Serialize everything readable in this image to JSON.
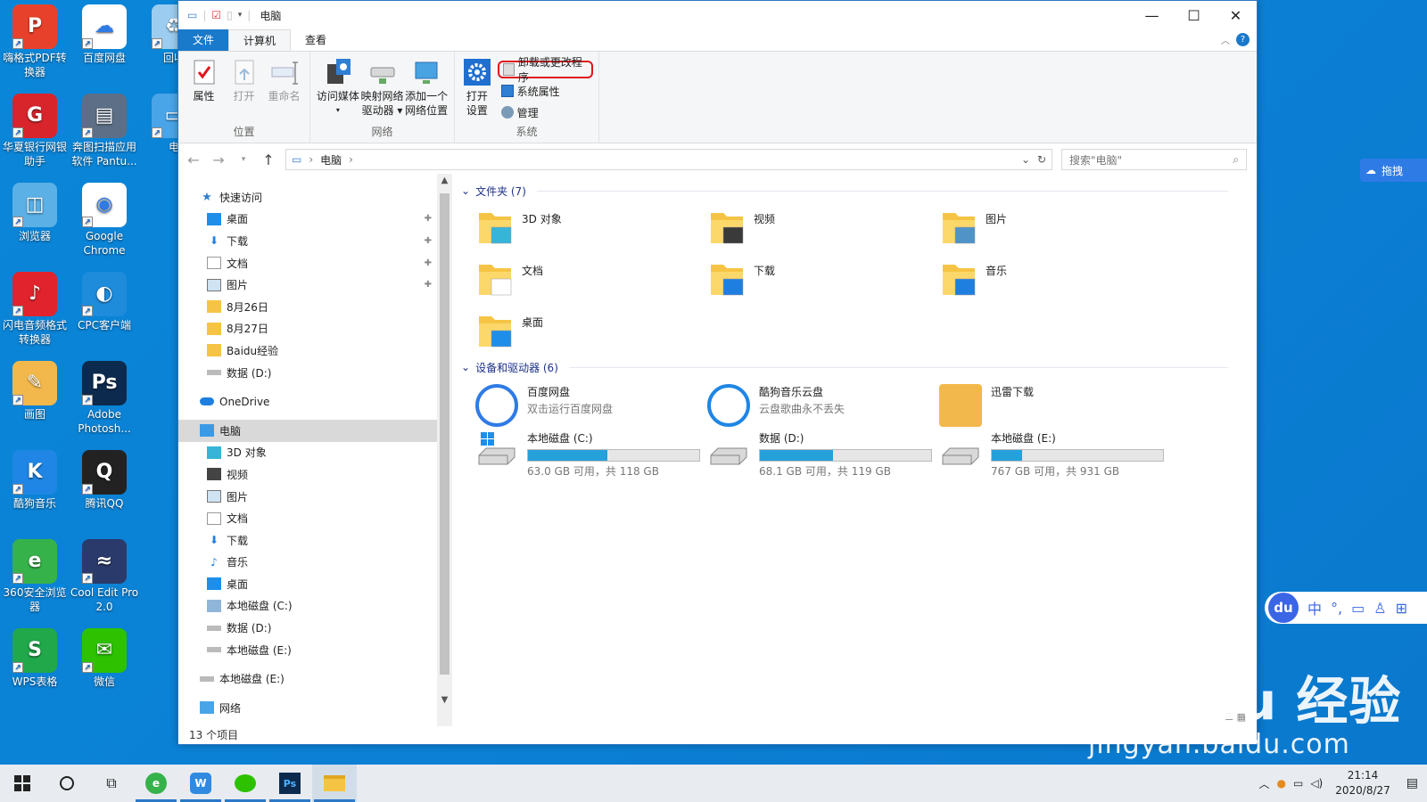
{
  "desktop": {
    "icons": [
      {
        "label": "嗨格式PDF转换器",
        "icon": "pdf-converter-icon",
        "color": "#e8412b",
        "glyph": "P"
      },
      {
        "label": "百度网盘",
        "icon": "baidu-netdisk-icon",
        "color": "#ffffff",
        "glyph": "☁"
      },
      {
        "label": "回收",
        "icon": "recycle-bin-icon",
        "color": "#9ccdf0",
        "glyph": "♻"
      },
      {
        "label": "华夏银行网银助手",
        "icon": "huaxia-bank-icon",
        "color": "#d8252c",
        "glyph": "G"
      },
      {
        "label": "奔图扫描应用软件 Pantu...",
        "icon": "scanner-icon",
        "color": "#5d6f86",
        "glyph": "▤"
      },
      {
        "label": "电",
        "icon": "computer-icon",
        "color": "#4aa5e8",
        "glyph": "▭"
      },
      {
        "label": "浏览器",
        "icon": "browser-icon",
        "color": "#5bb0e6",
        "glyph": "◫"
      },
      {
        "label": "Google Chrome",
        "icon": "chrome-icon",
        "color": "#ffffff",
        "glyph": "◉"
      },
      {
        "label": "闪电音频格式转换器",
        "icon": "audio-converter-icon",
        "color": "#e0232d",
        "glyph": "♪"
      },
      {
        "label": "CPC客户端",
        "icon": "cpc-client-icon",
        "color": "#1e8bdb",
        "glyph": "◐"
      },
      {
        "label": "画图",
        "icon": "paint-icon",
        "color": "#f2b84b",
        "glyph": "✎"
      },
      {
        "label": "Adobe Photosh...",
        "icon": "photoshop-icon",
        "color": "#0c2a4e",
        "glyph": "Ps"
      },
      {
        "label": "酷狗音乐",
        "icon": "kugou-icon",
        "color": "#1f86e5",
        "glyph": "K"
      },
      {
        "label": "腾讯QQ",
        "icon": "qq-icon",
        "color": "#222222",
        "glyph": "Q"
      },
      {
        "label": "360安全浏览器",
        "icon": "360-browser-icon",
        "color": "#36b24a",
        "glyph": "e"
      },
      {
        "label": "Cool Edit Pro 2.0",
        "icon": "cool-edit-icon",
        "color": "#2a3a6a",
        "glyph": "≈"
      },
      {
        "label": "WPS表格",
        "icon": "wps-sheet-icon",
        "color": "#20a84a",
        "glyph": "S"
      },
      {
        "label": "微信",
        "icon": "wechat-icon",
        "color": "#2dc100",
        "glyph": "✉"
      }
    ]
  },
  "window": {
    "title": "电脑",
    "ribbon_tabs": [
      "文件",
      "计算机",
      "查看"
    ],
    "groups": {
      "location": {
        "label": "位置",
        "buttons": [
          "属性",
          "打开",
          "重命名"
        ]
      },
      "network": {
        "label": "网络",
        "buttons": [
          "访问媒体",
          "映射网络驱动器",
          "添加一个网络位置"
        ],
        "b1_l1": "访问媒体",
        "b2_l1": "映射网络",
        "b2_l2": "驱动器",
        "b3_l1": "添加一个",
        "b3_l2": "网络位置"
      },
      "system": {
        "label": "系统",
        "open_settings_l1": "打开",
        "open_settings_l2": "设置",
        "uninstall": "卸载或更改程序",
        "system_properties": "系统属性",
        "manage": "管理"
      }
    },
    "address": {
      "path": "电脑",
      "search_placeholder": "搜索\"电脑\""
    },
    "nav": [
      {
        "label": "快速访问",
        "icon": "star-icon",
        "level": 0,
        "pinned": false
      },
      {
        "label": "桌面",
        "icon": "desktop-folder-icon",
        "level": 1,
        "pinned": true
      },
      {
        "label": "下载",
        "icon": "download-icon",
        "level": 1,
        "pinned": true
      },
      {
        "label": "文档",
        "icon": "document-icon",
        "level": 1,
        "pinned": true
      },
      {
        "label": "图片",
        "icon": "picture-icon",
        "level": 1,
        "pinned": true
      },
      {
        "label": "8月26日",
        "icon": "folder-icon",
        "level": 1,
        "pinned": false
      },
      {
        "label": "8月27日",
        "icon": "folder-icon",
        "level": 1,
        "pinned": false
      },
      {
        "label": "Baidu经验",
        "icon": "folder-icon",
        "level": 1,
        "pinned": false
      },
      {
        "label": "数据 (D:)",
        "icon": "drive-icon",
        "level": 1,
        "pinned": false
      },
      {
        "label": "",
        "icon": "",
        "level": -1,
        "pinned": false
      },
      {
        "label": "OneDrive",
        "icon": "onedrive-icon",
        "level": 0,
        "pinned": false
      },
      {
        "label": "",
        "icon": "",
        "level": -1,
        "pinned": false
      },
      {
        "label": "电脑",
        "icon": "computer-icon",
        "level": 0,
        "pinned": false,
        "selected": true
      },
      {
        "label": "3D 对象",
        "icon": "3d-objects-icon",
        "level": 1,
        "pinned": false
      },
      {
        "label": "视频",
        "icon": "video-icon",
        "level": 1,
        "pinned": false
      },
      {
        "label": "图片",
        "icon": "picture-icon",
        "level": 1,
        "pinned": false
      },
      {
        "label": "文档",
        "icon": "document-icon",
        "level": 1,
        "pinned": false
      },
      {
        "label": "下载",
        "icon": "download-icon",
        "level": 1,
        "pinned": false
      },
      {
        "label": "音乐",
        "icon": "music-icon",
        "level": 1,
        "pinned": false
      },
      {
        "label": "桌面",
        "icon": "desktop-folder-icon",
        "level": 1,
        "pinned": false
      },
      {
        "label": "本地磁盘 (C:)",
        "icon": "windows-drive-icon",
        "level": 1,
        "pinned": false
      },
      {
        "label": "数据 (D:)",
        "icon": "drive-icon",
        "level": 1,
        "pinned": false
      },
      {
        "label": "本地磁盘 (E:)",
        "icon": "drive-icon",
        "level": 1,
        "pinned": false
      },
      {
        "label": "",
        "icon": "",
        "level": -1,
        "pinned": false
      },
      {
        "label": "本地磁盘 (E:)",
        "icon": "drive-icon",
        "level": 0,
        "pinned": false
      },
      {
        "label": "",
        "icon": "",
        "level": -1,
        "pinned": false
      },
      {
        "label": "网络",
        "icon": "network-icon",
        "level": 0,
        "pinned": false
      }
    ],
    "folders_header": "文件夹 (7)",
    "folders": [
      {
        "name": "3D 对象",
        "icon": "3d-objects-folder-icon",
        "accent": "#36b5d8"
      },
      {
        "name": "视频",
        "icon": "video-folder-icon",
        "accent": "#3a3a3a"
      },
      {
        "name": "图片",
        "icon": "pictures-folder-icon",
        "accent": "#4f93c9"
      },
      {
        "name": "文档",
        "icon": "documents-folder-icon",
        "accent": "#ffffff"
      },
      {
        "name": "下载",
        "icon": "downloads-folder-icon",
        "accent": "#1f7fe0"
      },
      {
        "name": "音乐",
        "icon": "music-folder-icon",
        "accent": "#1f7fe0"
      },
      {
        "name": "桌面",
        "icon": "desktop-folder-icon",
        "accent": "#1f8ee8"
      }
    ],
    "devices_header": "设备和驱动器 (6)",
    "apps": [
      {
        "name": "百度网盘",
        "sub": "双击运行百度网盘",
        "icon": "baidu-netdisk-icon"
      },
      {
        "name": "酷狗音乐云盘",
        "sub": "云盘歌曲永不丢失",
        "icon": "kugou-cloud-icon"
      },
      {
        "name": "迅雷下载",
        "sub": "",
        "icon": "xunlei-icon"
      }
    ],
    "drives": [
      {
        "name": "本地磁盘 (C:)",
        "sub": "63.0 GB 可用，共 118 GB",
        "used_fraction": 0.466,
        "icon": "windows-drive-icon"
      },
      {
        "name": "数据 (D:)",
        "sub": "68.1 GB 可用，共 119 GB",
        "used_fraction": 0.428,
        "icon": "drive-icon"
      },
      {
        "name": "本地磁盘 (E:)",
        "sub": "767 GB 可用，共 931 GB",
        "used_fraction": 0.176,
        "icon": "drive-icon"
      }
    ],
    "status": "13 个项目"
  },
  "taskbar": {
    "time": "21:14",
    "date": "2020/8/27",
    "apps": [
      "360-browser-icon",
      "wps-writer-icon",
      "wechat-icon",
      "photoshop-icon",
      "file-explorer-icon"
    ]
  },
  "ime": {
    "lang": "中"
  },
  "baidu_widget": {
    "label": "拖拽"
  },
  "watermark": {
    "line1": "Bai du 经验",
    "line2": "jingyan.baidu.com"
  }
}
